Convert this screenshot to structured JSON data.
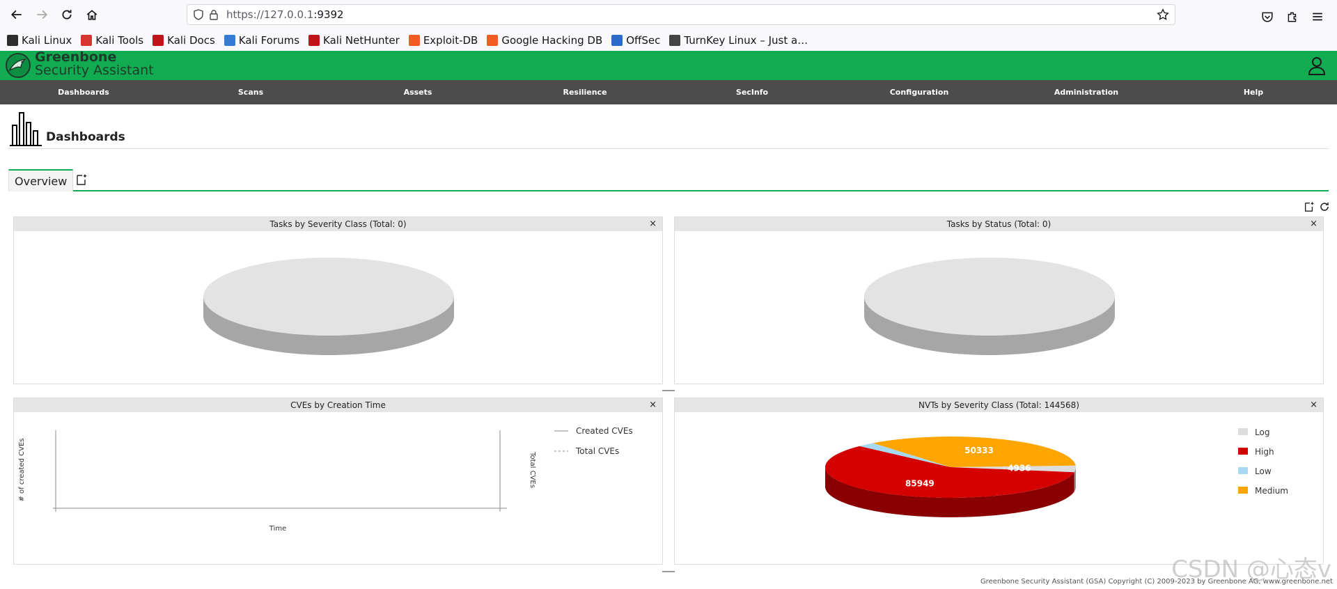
{
  "browser": {
    "url_prefix": "https://127.0.0.1",
    "url_port": ":9392",
    "bookmarks": [
      {
        "label": "Kali Linux",
        "color": "#2d2d2d"
      },
      {
        "label": "Kali Tools",
        "color": "#d6362f"
      },
      {
        "label": "Kali Docs",
        "color": "#c0141a"
      },
      {
        "label": "Kali Forums",
        "color": "#367bd8"
      },
      {
        "label": "Kali NetHunter",
        "color": "#c0141a"
      },
      {
        "label": "Exploit-DB",
        "color": "#f25c22"
      },
      {
        "label": "Google Hacking DB",
        "color": "#f25c22"
      },
      {
        "label": "OffSec",
        "color": "#2a6ac8"
      },
      {
        "label": "TurnKey Linux – Just a…",
        "color": "#444"
      }
    ]
  },
  "gsa": {
    "brand_line1": "Greenbone",
    "brand_line2": "Security Assistant",
    "menu": [
      "Dashboards",
      "Scans",
      "Assets",
      "Resilience",
      "SecInfo",
      "Configuration",
      "Administration",
      "Help"
    ],
    "page_title": "Dashboards",
    "tab_overview": "Overview"
  },
  "panels": {
    "tasks_severity": {
      "title": "Tasks by Severity Class (Total: 0)",
      "close": "×"
    },
    "tasks_status": {
      "title": "Tasks by Status (Total: 0)",
      "close": "×"
    },
    "cves": {
      "title": "CVEs by Creation Time",
      "close": "×"
    },
    "nvts": {
      "title": "NVTs by Severity Class (Total: 144568)",
      "close": "×"
    }
  },
  "chart_data": [
    {
      "type": "pie",
      "title": "Tasks by Severity Class (Total: 0)",
      "values": []
    },
    {
      "type": "pie",
      "title": "Tasks by Status (Total: 0)",
      "values": []
    },
    {
      "type": "line",
      "title": "CVEs by Creation Time",
      "xlabel": "Time",
      "ylabel": "# of created CVEs",
      "y2label": "Total CVEs",
      "series": [
        {
          "name": "Created CVEs",
          "values": []
        },
        {
          "name": "Total CVEs",
          "values": []
        }
      ],
      "legend_placement": "top-right"
    },
    {
      "type": "pie",
      "title": "NVTs by Severity Class (Total: 144568)",
      "categories": [
        "Log",
        "High",
        "Low",
        "Medium"
      ],
      "values": [
        4936,
        85949,
        3350,
        50333
      ],
      "value_labels": [
        "4936",
        "85949",
        "",
        "50333"
      ],
      "colors": [
        "#dddddd",
        "#d50000",
        "#a7d9f0",
        "#ffa500"
      ],
      "legend_placement": "right"
    }
  ],
  "footer": "Greenbone Security Assistant (GSA) Copyright (C) 2009-2023 by Greenbone AG, www.greenbone.net",
  "watermark": "CSDN @心态v"
}
